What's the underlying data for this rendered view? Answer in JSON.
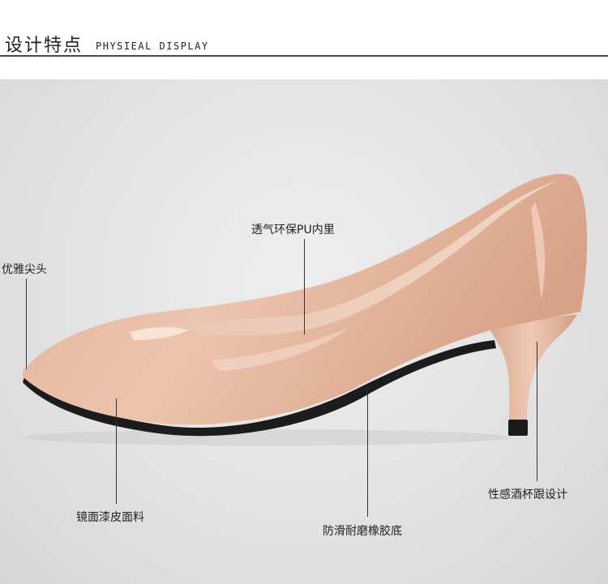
{
  "header": {
    "title": "设计特点",
    "subtitle": "PHYSIEAL DISPLAY"
  },
  "callouts": {
    "toe": "优雅尖头",
    "lining": "透气环保PU内里",
    "upper": "镜面漆皮面料",
    "sole": "防滑耐磨橡胶底",
    "heel": "性感酒杯跟设计"
  },
  "colors": {
    "accent": "#e7bca6",
    "rule": "#4a4a4a",
    "text": "#222222"
  }
}
